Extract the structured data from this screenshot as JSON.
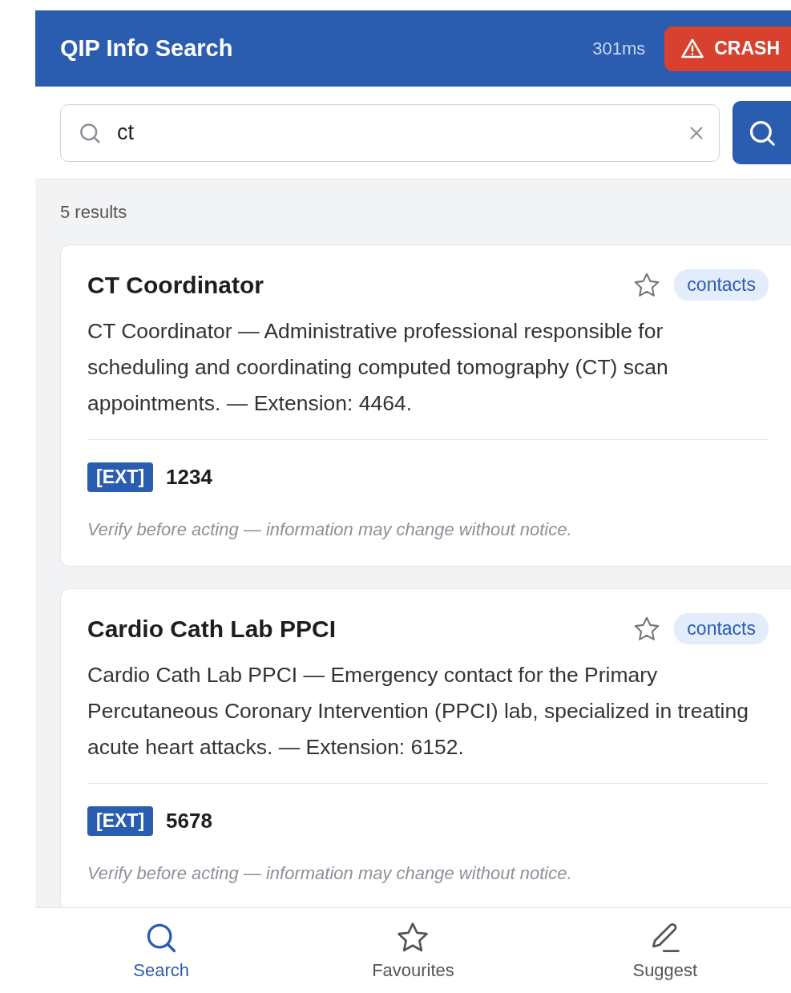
{
  "header": {
    "title": "QIP Info Search",
    "timing": "301ms",
    "crash_button": "CRASH"
  },
  "search": {
    "value": "ct"
  },
  "results_count": "5 results",
  "results": [
    {
      "title": "CT Coordinator",
      "favourite": false,
      "tag": "contacts",
      "description": "CT Coordinator — Administrative professional responsible for scheduling and coordinating computed tomography (CT) scan appointments. — Extension: 4464.",
      "ext_label": "[EXT]",
      "ext_number": "1234",
      "note": "Verify before acting — information may change without notice."
    },
    {
      "title": "Cardio Cath Lab PPCI",
      "favourite": false,
      "tag": "contacts",
      "description": "Cardio Cath Lab PPCI — Emergency contact for the Primary Percutaneous Coronary Intervention (PPCI) lab, specialized in treating acute heart attacks. — Extension: 6152.",
      "ext_label": "[EXT]",
      "ext_number": "5678",
      "note": "Verify before acting — information may change without notice."
    }
  ],
  "nav": [
    {
      "kind": "search",
      "label": "Search",
      "selected": true
    },
    {
      "kind": "favourites",
      "label": "Favourites",
      "selected": false
    },
    {
      "kind": "suggest",
      "label": "Suggest",
      "selected": false
    }
  ]
}
